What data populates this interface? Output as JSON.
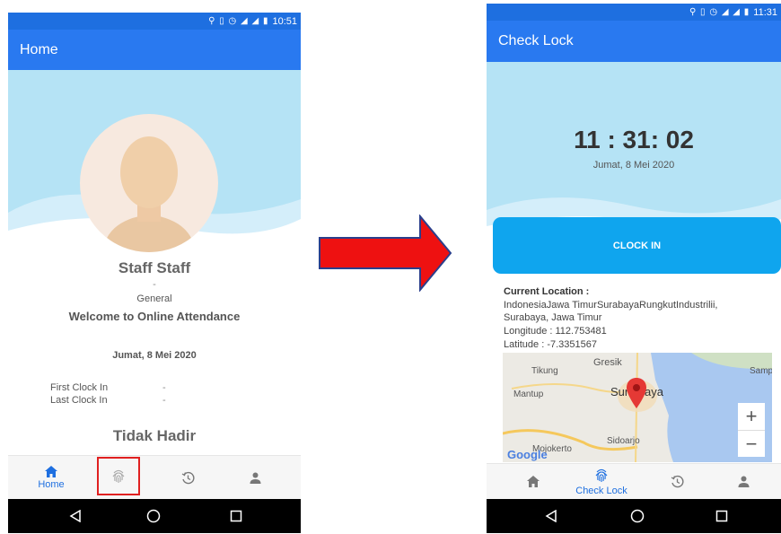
{
  "left": {
    "status_time": "10:51",
    "title": "Home",
    "name": "Staff Staff",
    "dash": "-",
    "department": "General",
    "welcome": "Welcome to Online Attendance",
    "date": "Jumat, 8 Mei 2020",
    "first_clock_label": "First Clock In",
    "first_clock_value": "-",
    "last_clock_label": "Last Clock In",
    "last_clock_value": "-",
    "attendance_status": "Tidak Hadir",
    "nav_home_label": "Home"
  },
  "right": {
    "status_time": "11:31",
    "title": "Check Lock",
    "clock_time": "11 : 31: 02",
    "date": "Jumat, 8 Mei 2020",
    "clock_in_button": "CLOCK IN",
    "location_label": "Current Location :",
    "address_line1": "IndonesiaJawa TimurSurabayaRungkutIndustrilii,",
    "address_line2": "Surabaya, Jawa Timur",
    "longitude": "Longitude : 112.753481",
    "latitude": "Latitude : -7.3351567",
    "map_labels": {
      "gresik": "Gresik",
      "tikung": "Tikung",
      "samp": "Samp",
      "mantup": "Mantup",
      "surabaya_left": "Sur",
      "surabaya_right": "aya",
      "sidoarjo": "Sidoarjo",
      "mojokerto": "Mojokerto",
      "google": "Google"
    },
    "zoom_in": "+",
    "zoom_out": "−",
    "nav_checklock_label": "Check Lock"
  },
  "colors": {
    "appbar": "#2979f0",
    "statusbar": "#1e6fe0",
    "hero": "#b5e3f5",
    "clock_button": "#0fa5ee",
    "arrow_red": "#ee1111",
    "arrow_outline": "#2b3f8c",
    "highlight_box": "#e02020"
  }
}
